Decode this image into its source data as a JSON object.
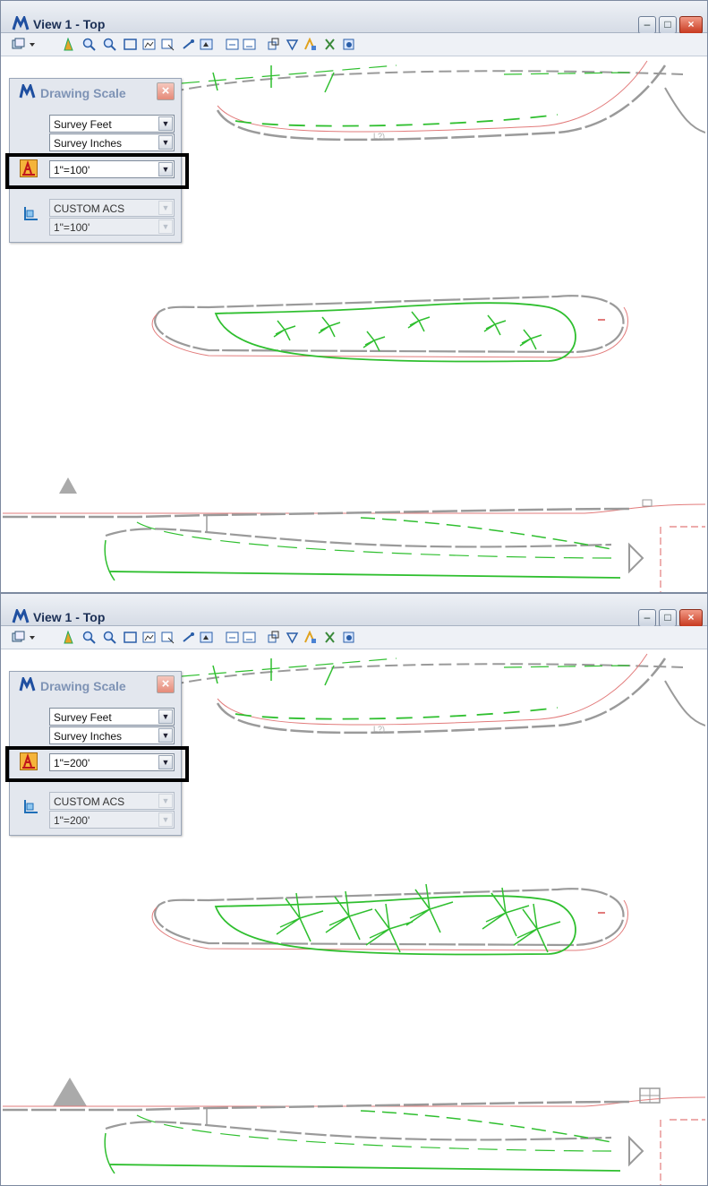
{
  "views": [
    {
      "window": {
        "title": "View 1 - Top"
      },
      "palette": {
        "title": "Drawing Scale",
        "master_units": "Survey Feet",
        "sub_units": "Survey Inches",
        "scale": "1\"=100'",
        "acs": "CUSTOM ACS",
        "acs_scale": "1\"=100'"
      }
    },
    {
      "window": {
        "title": "View 1 - Top"
      },
      "palette": {
        "title": "Drawing Scale",
        "master_units": "Survey Feet",
        "sub_units": "Survey Inches",
        "scale": "1\"=200'",
        "acs": "CUSTOM ACS",
        "acs_scale": "1\"=200'"
      }
    }
  ],
  "drawing": {
    "annotation_text": "L?)",
    "line_colors": {
      "green": "#2fbf2f",
      "red": "#e27b7b",
      "gray": "#9a9a9a"
    }
  }
}
